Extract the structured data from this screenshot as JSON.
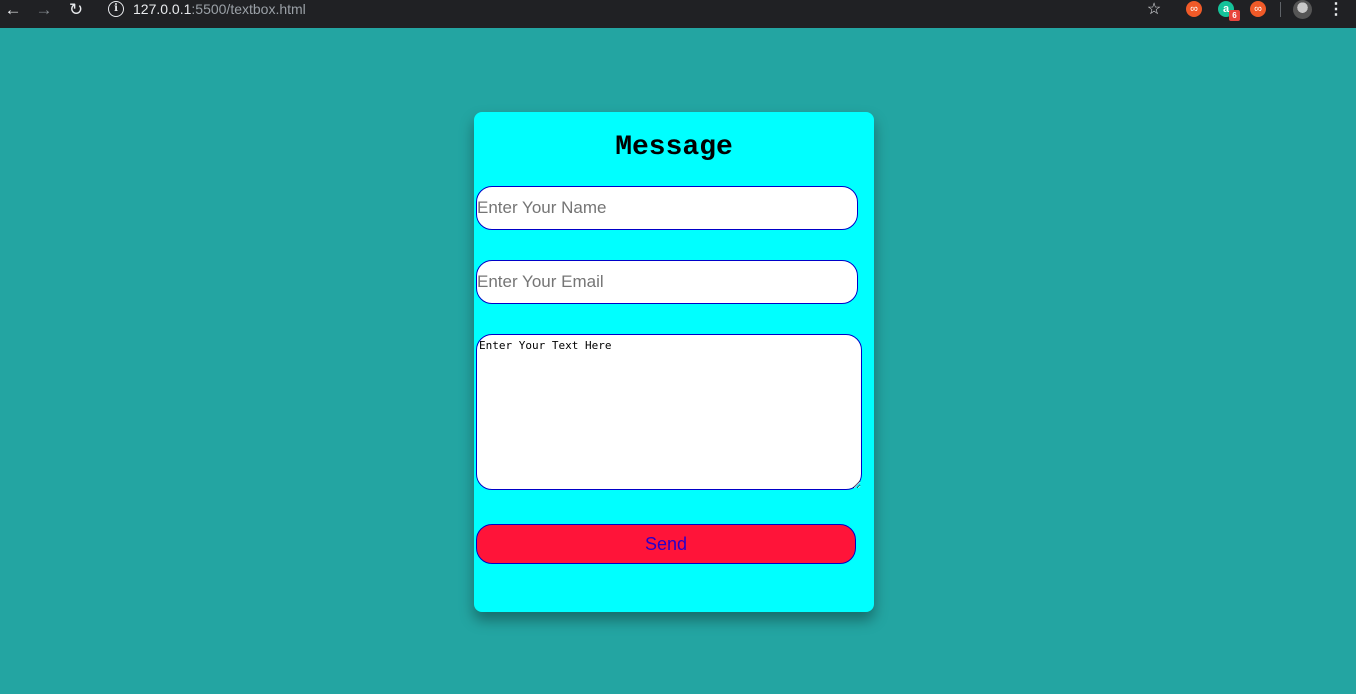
{
  "browser": {
    "url_host": "127.0.0.1",
    "url_rest": ":5500/textbox.html",
    "back_icon": "arrow-left-icon",
    "forward_icon": "arrow-right-icon",
    "reload_icon": "reload-icon",
    "info_icon": "info-icon",
    "star_icon": "star-icon",
    "extension_badge": "6"
  },
  "form": {
    "title": "Message",
    "name_placeholder": "Enter Your Name",
    "email_placeholder": "Enter Your Email",
    "message_placeholder": "Enter Your Text Here",
    "send_label": "Send"
  },
  "colors": {
    "page_background": "#23a5a2",
    "card_background": "#00ffff",
    "field_border": "#0000c8",
    "button_background": "#ff1439",
    "button_text": "#2a00c8"
  }
}
